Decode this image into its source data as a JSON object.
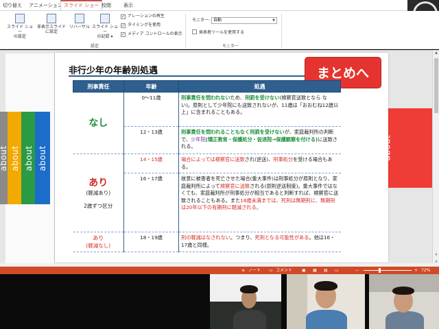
{
  "tabs": [
    {
      "label": "切り替え",
      "active": false
    },
    {
      "label": "アニメーション",
      "active": false
    },
    {
      "label": "スライド ショー",
      "active": true
    },
    {
      "label": "校閲",
      "active": false
    },
    {
      "label": "表示",
      "active": false
    }
  ],
  "ribbon": {
    "start_group": {
      "btn_from_slide_1": "スライド ショー",
      "btn_from_slide_2": "の設定",
      "btn_hide_1": "非表示スライド",
      "btn_hide_2": "に設定",
      "btn_rehearse": "リハーサル",
      "btn_record_1": "スライド ショー",
      "btn_record_2": "の記録 ▾",
      "label": "設定"
    },
    "checkboxes": [
      {
        "label": "ナレーションの再生",
        "checked": true
      },
      {
        "label": "タイミングを使用",
        "checked": true
      },
      {
        "label": "メディア コントロールの表示",
        "checked": true
      }
    ],
    "monitor": {
      "monitor_label": "モニター:",
      "monitor_value": "自動",
      "presenter_label": "発表者ツールを使用する",
      "group_label": "モニター"
    }
  },
  "slide": {
    "title": "非行少年の年齢別処遇",
    "summary_button": "まとめへ",
    "side_tab_label": "about",
    "table": {
      "headers": [
        "刑事責任",
        "年齢",
        "処遇"
      ],
      "nashi_label": "なし",
      "ari_label": "あり",
      "ari_sub1": "(軽減あり)",
      "ari_sub2": "2歳ずつ区分",
      "last_ari": "あり",
      "last_ari_sub": "(軽減なし)",
      "age_0_11": "0〜11歳",
      "age_12_13": "12・13歳",
      "age_14_15": "14・15歳",
      "age_16_17": "16・17歳",
      "age_18_19": "18・19歳",
      "row1": {
        "a": "刑事責任を問われない",
        "b": "ため、",
        "c": "刑罰を受けない",
        "d": "(検察官送致となら ない)。原則として少年院にも送致されないが、11歳は「おおむね12歳以上」に含まれることもある。"
      },
      "row2": {
        "a": "刑事責任を問われることもなく刑罰を受けない",
        "b": "が、家庭裁判所の判断で、",
        "c": "少年院",
        "d": "(矯正教育・保護処分・仮退院→保護観察を付ける)",
        "e": "に送致される。"
      },
      "row3": {
        "a": "場合によっては検察官に送致",
        "b": "され(逆送)、",
        "c": "刑事処分",
        "d": "を受ける場合もある。"
      },
      "row4": {
        "a": "故意に被害者を死亡させた場合(重大事件)は刑事処分が原則となり、家庭裁判所によって",
        "b": "検察官に送致",
        "c": "される(原則逆送制度)。重大事件ではなくても、家庭裁判所が刑事処分が相当であると判断すれば、検察官に送致されることもある。また",
        "d": "18歳未満までは、死刑は無期刑に、無期刑は20年以下の有期刑に軽減される。"
      },
      "row5": {
        "a": "刑の軽減はなされない",
        "b": "。つまり、",
        "c": "死刑となる可能性がある",
        "d": "。他は16・17歳と同様。"
      }
    }
  },
  "statusbar": {
    "notes": "ノート",
    "comments": "コメント",
    "zoom": "72%"
  },
  "colors": {
    "accent": "#d04a27",
    "header_blue": "#2f5f8f",
    "green_text": "#1a8e3a",
    "red_text": "#d42b25",
    "summary_red": "#e5342f",
    "side_tabs": [
      "#8a8a8a",
      "#f2a900",
      "#2a9a45",
      "#1c6cc9"
    ]
  }
}
